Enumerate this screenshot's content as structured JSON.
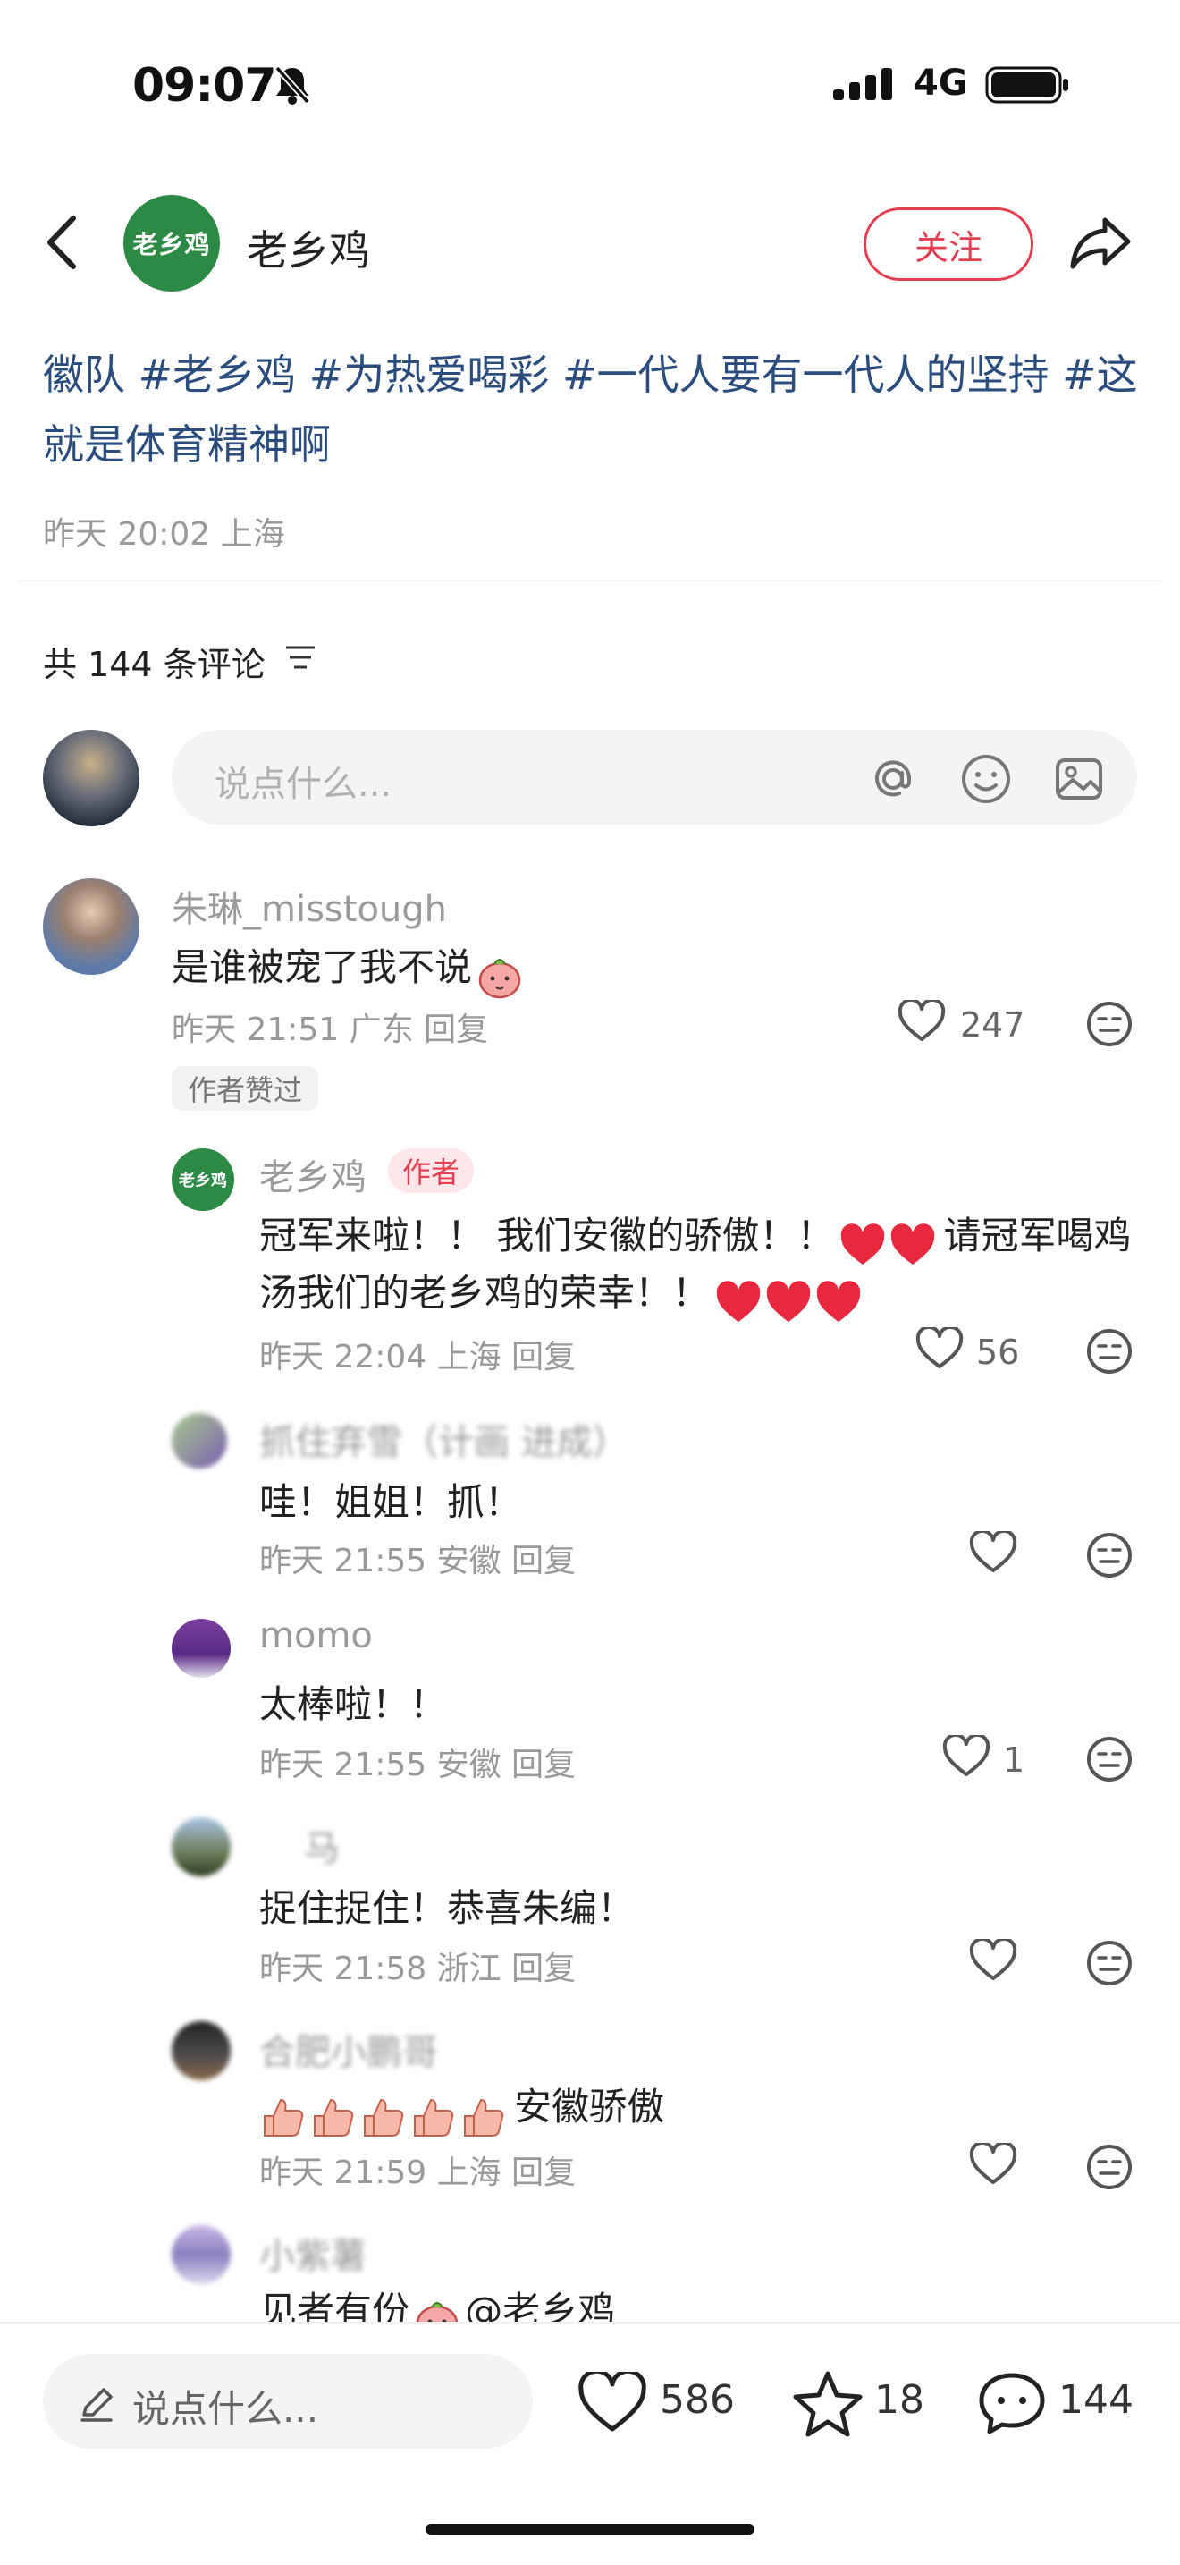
{
  "status_bar": {
    "time": "09:07",
    "network": "4G"
  },
  "header": {
    "account_logo_text": "老乡鸡",
    "account_name": "老乡鸡",
    "follow_label": "关注"
  },
  "post": {
    "text": "徽队 #老乡鸡 #为热爱喝彩 #一代人要有一代人的坚持 #这就是体育精神啊",
    "meta": "昨天 20:02 上海"
  },
  "comments_header": {
    "count_label": "共 144 条评论"
  },
  "comment_input": {
    "placeholder": "说点什么..."
  },
  "comments": [
    {
      "user": "朱琳_misstough",
      "text": "是谁被宠了我不说",
      "meta": "昨天 21:51 广东 回复",
      "likes": "247",
      "badge": "作者赞过"
    },
    {
      "user": "老乡鸡",
      "tag": "作者",
      "text_line1": "冠军来啦！！ 我们安徽的骄傲！！",
      "text_line1_tail": "请冠军喝鸡",
      "text_line2": "汤我们的老乡鸡的荣幸！！",
      "meta": "昨天 22:04 上海 回复",
      "likes": "56"
    },
    {
      "user": "抓住弃雪（计画 进成）",
      "text": "哇！姐姐！抓！",
      "meta": "昨天 21:55 安徽 回复",
      "likes": ""
    },
    {
      "user": "momo",
      "text": "太棒啦！！",
      "meta": "昨天 21:55 安徽 回复",
      "likes": "1"
    },
    {
      "user": "马",
      "text": "捉住捉住！恭喜朱编！",
      "meta": "昨天 21:58 浙江 回复",
      "likes": ""
    },
    {
      "user": "合肥小鹏哥",
      "text": "安徽骄傲",
      "meta": "昨天 21:59 上海 回复",
      "likes": ""
    },
    {
      "user": "小紫薯",
      "text": "见者有份",
      "text_tail": "@老乡鸡"
    }
  ],
  "bottom_bar": {
    "placeholder": "说点什么...",
    "likes": "586",
    "stars": "18",
    "comments": "144"
  },
  "colors": {
    "accent_red": "#e23f50",
    "hashtag_blue": "#2a4d7e",
    "brand_green": "#2c8a44"
  }
}
